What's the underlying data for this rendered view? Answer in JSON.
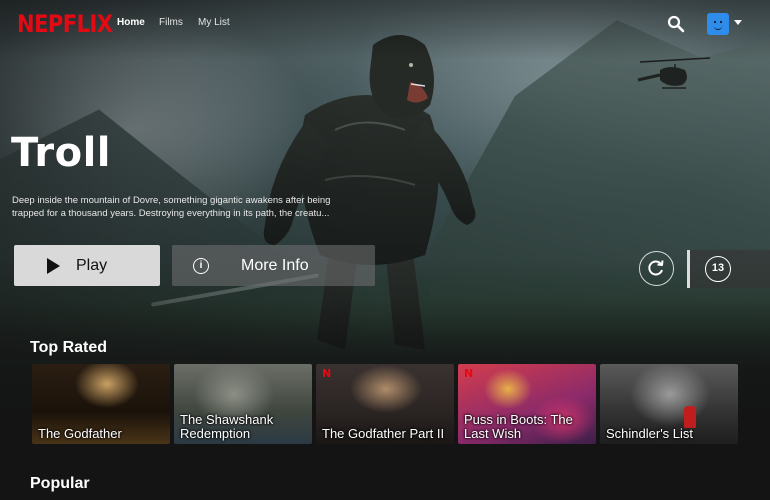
{
  "nav": {
    "logo": "NEPFLIX",
    "links": [
      {
        "label": "Home",
        "active": true
      },
      {
        "label": "Films",
        "active": false
      },
      {
        "label": "My List",
        "active": false
      }
    ],
    "icons": [
      "search-icon",
      "avatar",
      "caret-down-icon"
    ],
    "accent_color": "#e50914"
  },
  "hero": {
    "title": "Troll",
    "description": "Deep inside the mountain of Dovre, something gigantic awakens after being trapped for a thousand years. Destroying everything in its path, the creatu...",
    "play_label": "Play",
    "info_label": "More Info",
    "maturity_rating": "13",
    "replay_icon": "replay-icon"
  },
  "rows": [
    {
      "title": "Top Rated",
      "items": [
        {
          "label": "The Godfather",
          "netflix_badge": false
        },
        {
          "label": "The Shawshank Redemption",
          "netflix_badge": false
        },
        {
          "label": "The Godfather Part II",
          "netflix_badge": true
        },
        {
          "label": "Puss in Boots: The Last Wish",
          "netflix_badge": true
        },
        {
          "label": "Schindler's List",
          "netflix_badge": false
        }
      ]
    },
    {
      "title": "Popular",
      "items": []
    }
  ]
}
